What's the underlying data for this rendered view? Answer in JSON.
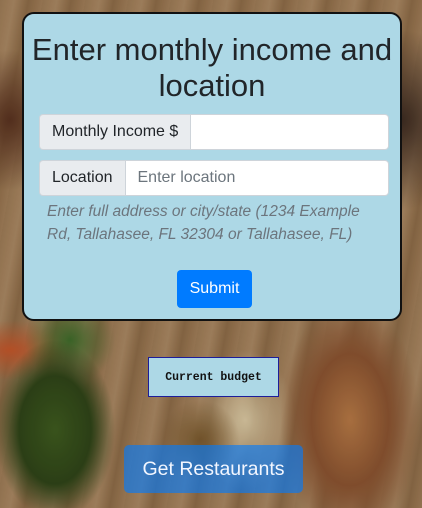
{
  "form": {
    "title": "Enter monthly income and location",
    "income_label": "Monthly Income $",
    "income_value": "",
    "income_placeholder": "",
    "location_label": "Location",
    "location_value": "",
    "location_placeholder": "Enter location",
    "hint": "Enter full address or city/state (1234 Example Rd, Tallahasee, FL 32304 or Tallahasee, FL)",
    "submit_label": "Submit"
  },
  "budget": {
    "label": "Current budget"
  },
  "actions": {
    "get_restaurants_label": "Get Restaurants"
  },
  "colors": {
    "card_background": "#add8e6",
    "primary": "#007bff"
  }
}
